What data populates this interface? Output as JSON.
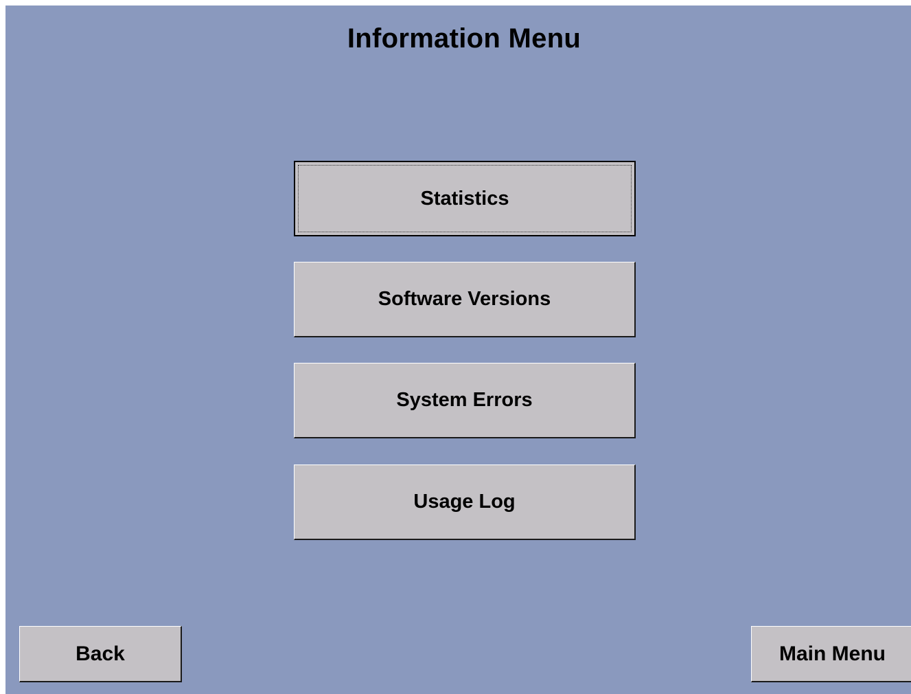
{
  "header": {
    "title": "Information Menu"
  },
  "menu": {
    "items": [
      {
        "label": "Statistics"
      },
      {
        "label": "Software Versions"
      },
      {
        "label": "System Errors"
      },
      {
        "label": "Usage Log"
      }
    ]
  },
  "footer": {
    "back_label": "Back",
    "main_menu_label": "Main Menu"
  },
  "colors": {
    "background": "#8a99be",
    "button_face": "#c4c1c5",
    "text": "#000000"
  }
}
